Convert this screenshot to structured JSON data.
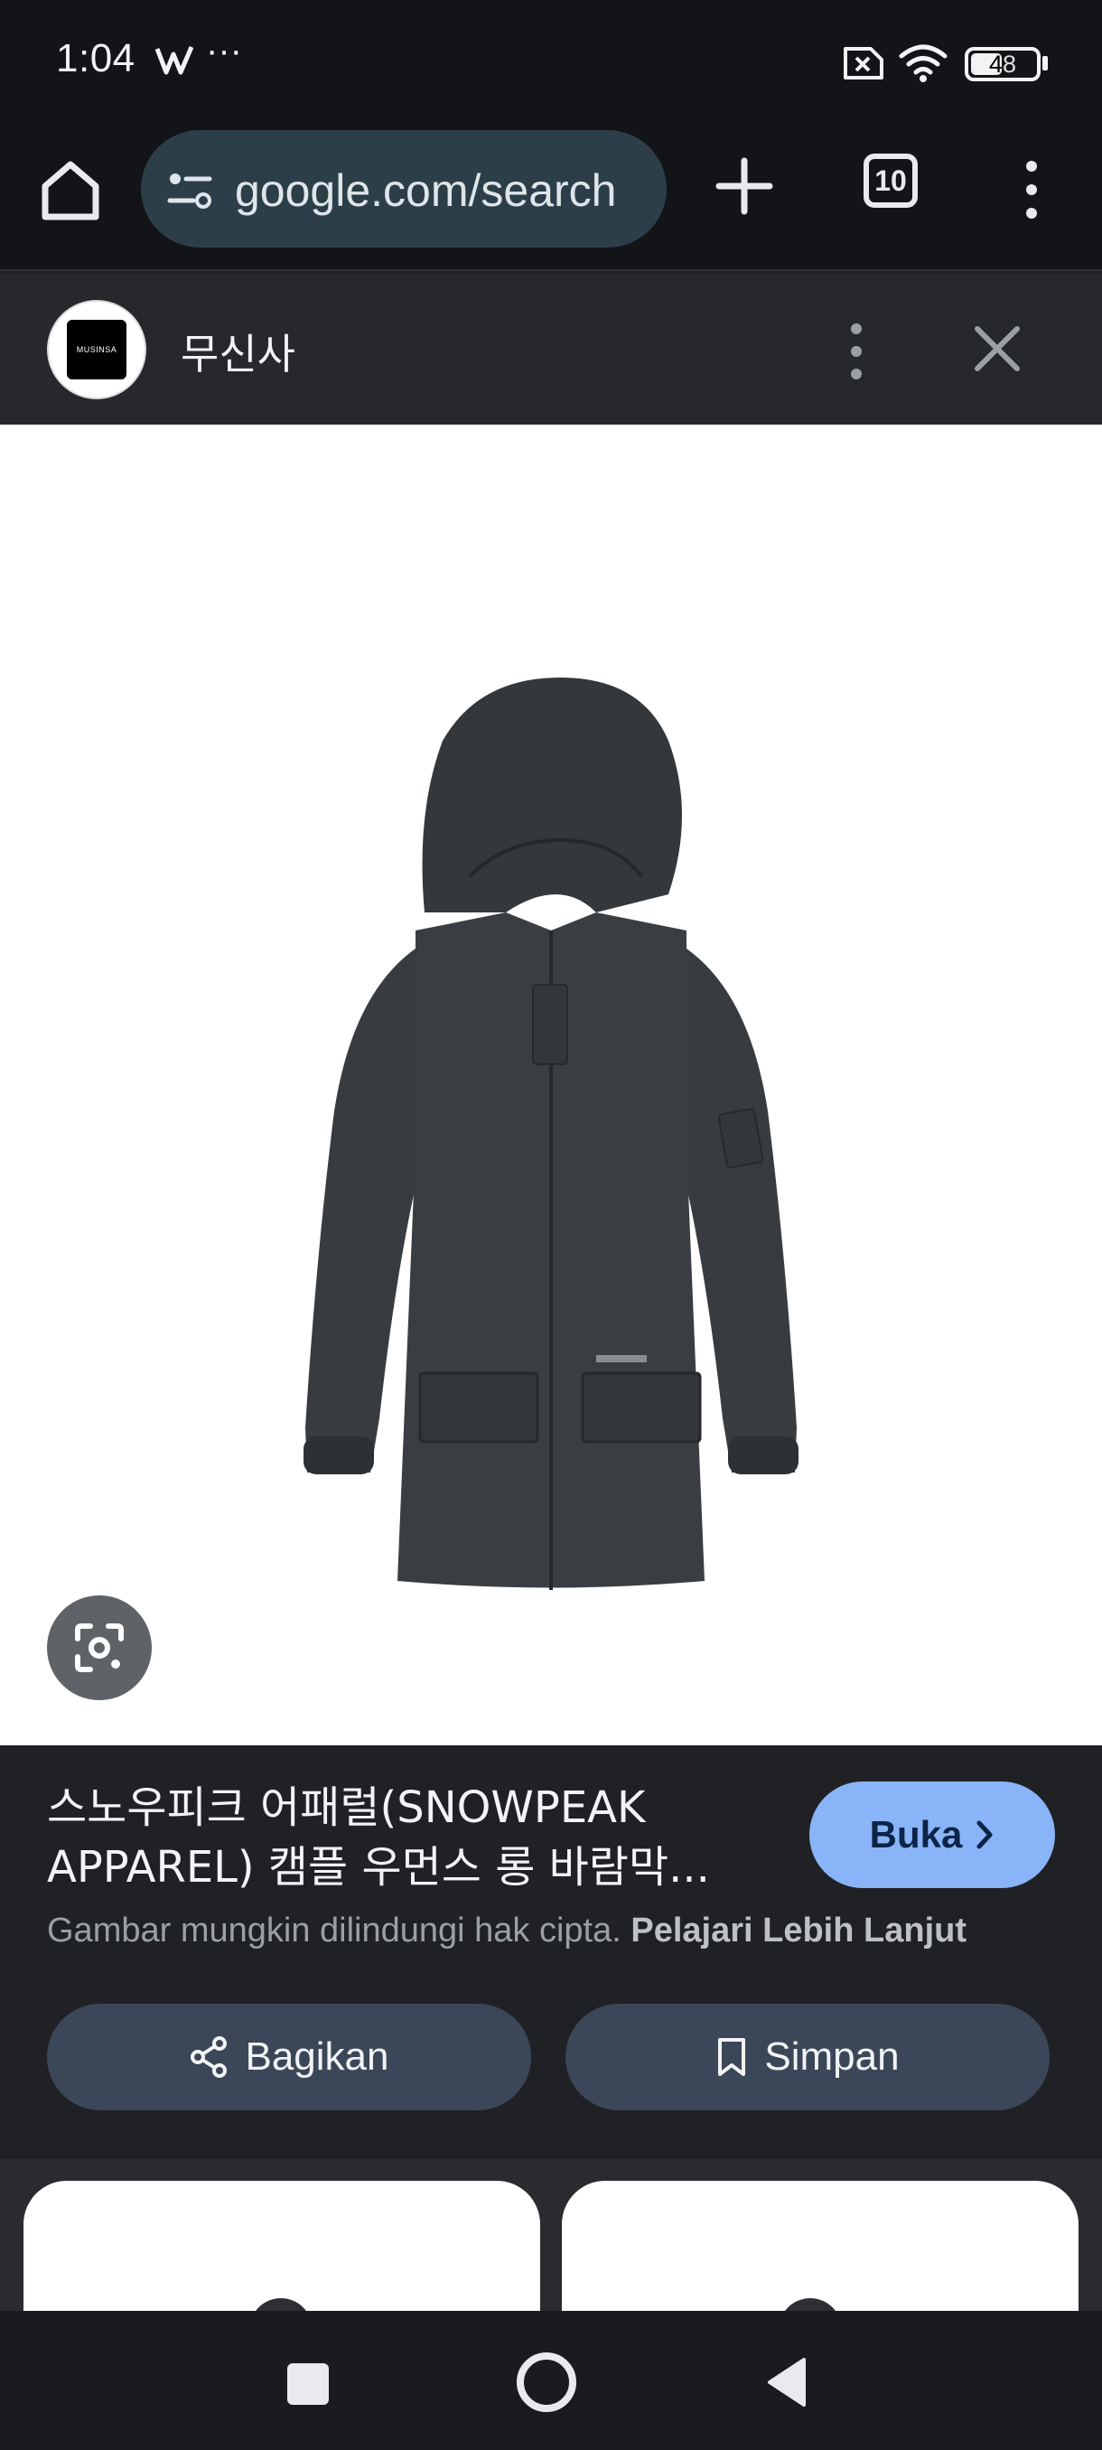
{
  "status_bar": {
    "time": "1:04",
    "overflow_dots": "···",
    "battery_level": "48"
  },
  "address_bar": {
    "url": "google.com/search",
    "tab_count": "10"
  },
  "source": {
    "name": "무신사",
    "logo_text": "MUSINSA"
  },
  "product": {
    "title": "스노우피크 어패럴(SNOWPEAK APPAREL) 캠플 우먼스 롱 바람막...",
    "open_label": "Buka",
    "copyright_notice": "Gambar mungkin dilindungi hak cipta.",
    "learn_more": "Pelajari Lebih Lanjut",
    "share_label": "Bagikan",
    "save_label": "Simpan"
  },
  "colors": {
    "accent": "#8ab4f8",
    "action_button": "#3b4658",
    "background": "#202124"
  }
}
